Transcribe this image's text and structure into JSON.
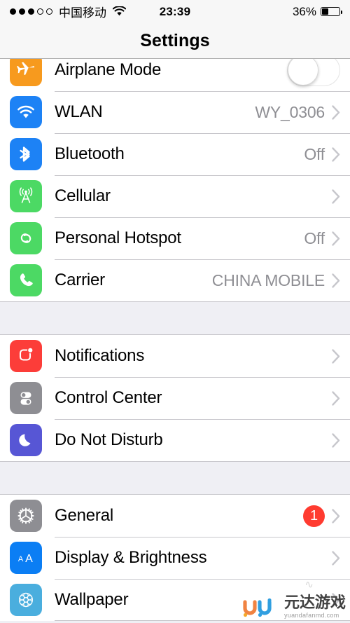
{
  "status_bar": {
    "signal_dots_filled": 3,
    "signal_dots_total": 5,
    "carrier": "中国移动",
    "wifi_icon": "wifi-icon",
    "time": "23:39",
    "battery_percent": "36%",
    "battery_level": 36
  },
  "nav": {
    "title": "Settings"
  },
  "groups": [
    {
      "id": "connectivity",
      "rows": [
        {
          "id": "airplane-mode",
          "label": "Airplane Mode",
          "icon": "airplane-icon",
          "icon_color": "#f79a1e",
          "accessory": "toggle",
          "toggle_on": false,
          "value": ""
        },
        {
          "id": "wlan",
          "label": "WLAN",
          "icon": "wifi-icon",
          "icon_color": "#1d82f5",
          "accessory": "chevron",
          "value": "WY_0306"
        },
        {
          "id": "bluetooth",
          "label": "Bluetooth",
          "icon": "bluetooth-icon",
          "icon_color": "#1d82f5",
          "accessory": "chevron",
          "value": "Off"
        },
        {
          "id": "cellular",
          "label": "Cellular",
          "icon": "cellular-antenna-icon",
          "icon_color": "#4cd964",
          "accessory": "chevron",
          "value": ""
        },
        {
          "id": "personal-hotspot",
          "label": "Personal Hotspot",
          "icon": "hotspot-link-icon",
          "icon_color": "#4cd964",
          "accessory": "chevron",
          "value": "Off"
        },
        {
          "id": "carrier",
          "label": "Carrier",
          "icon": "phone-icon",
          "icon_color": "#4cd964",
          "accessory": "chevron",
          "value": "CHINA MOBILE"
        }
      ]
    },
    {
      "id": "notifications-group",
      "rows": [
        {
          "id": "notifications",
          "label": "Notifications",
          "icon": "notification-badge-icon",
          "icon_color": "#fc3d39",
          "accessory": "chevron",
          "value": ""
        },
        {
          "id": "control-center",
          "label": "Control Center",
          "icon": "control-center-toggles-icon",
          "icon_color": "#8e8e93",
          "accessory": "chevron",
          "value": ""
        },
        {
          "id": "do-not-disturb",
          "label": "Do Not Disturb",
          "icon": "moon-icon",
          "icon_color": "#5756d5",
          "accessory": "chevron",
          "value": ""
        }
      ]
    },
    {
      "id": "system-group",
      "rows": [
        {
          "id": "general",
          "label": "General",
          "icon": "gear-icon",
          "icon_color": "#8e8e93",
          "accessory": "chevron",
          "value": "",
          "badge": "1"
        },
        {
          "id": "display-brightness",
          "label": "Display & Brightness",
          "icon": "aa-text-icon",
          "icon_color": "#0b7ef4",
          "accessory": "chevron",
          "value": ""
        },
        {
          "id": "wallpaper",
          "label": "Wallpaper",
          "icon": "flower-wallpaper-icon",
          "icon_color": "#4aaede",
          "accessory": "chevron",
          "value": ""
        }
      ]
    }
  ],
  "watermark": {
    "cn": "元达游戏",
    "en": "yuandafanmd.com"
  },
  "colors": {
    "badge_red": "#ff3b30",
    "value_gray": "#8e8e93",
    "separator": "#c8c7cc",
    "group_bg": "#efeff4"
  }
}
